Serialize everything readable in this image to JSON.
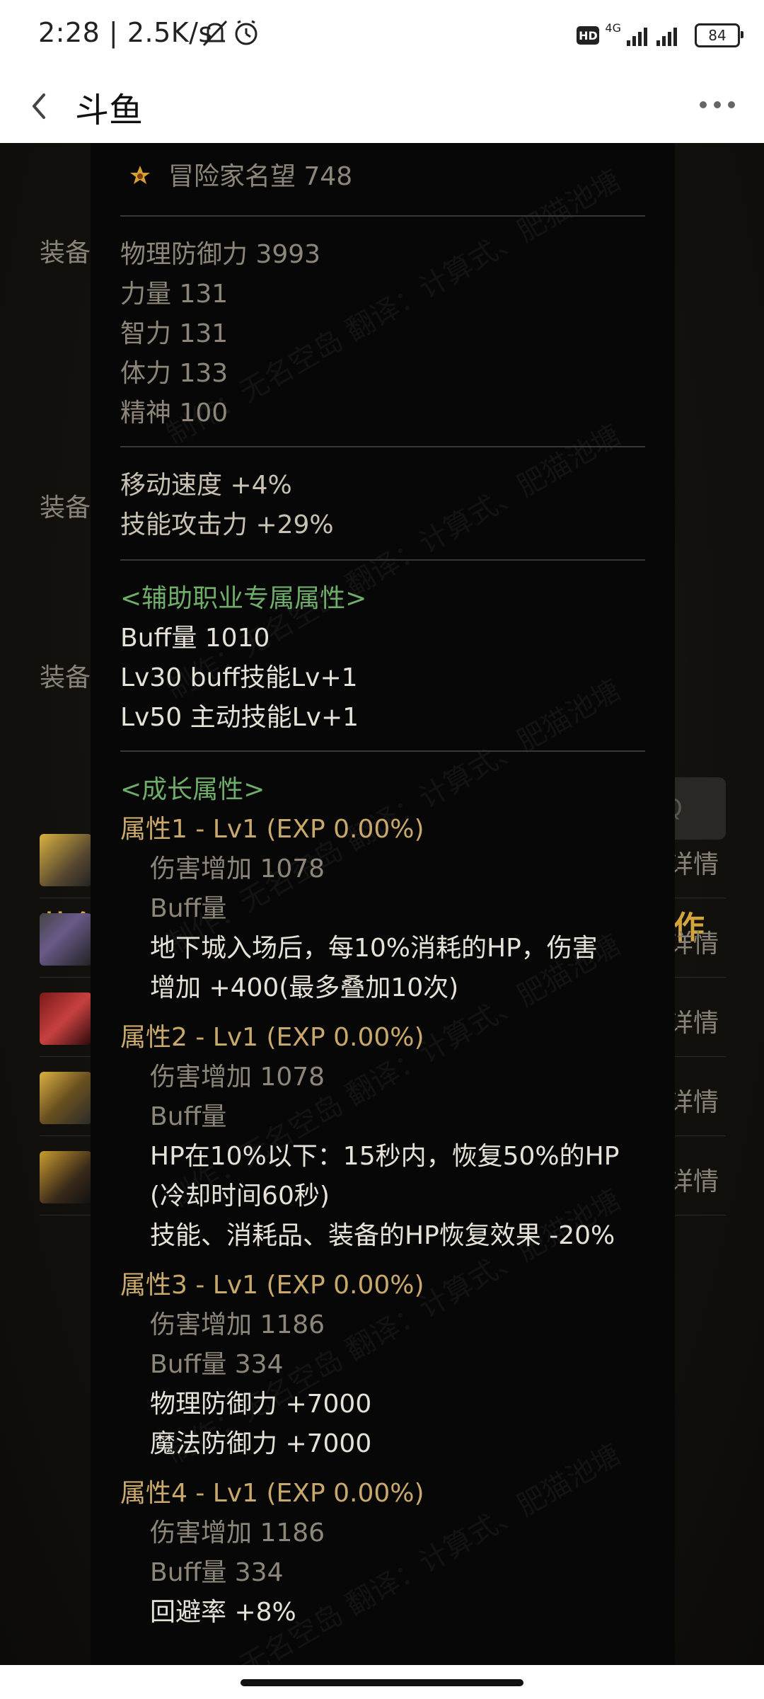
{
  "status_bar": {
    "time": "2:28",
    "speed": "2.5K/s",
    "hd": "HD",
    "network": "4G",
    "battery": "84"
  },
  "navbar": {
    "title": "斗鱼"
  },
  "background": {
    "labels": [
      "装备",
      "装备",
      "装备"
    ],
    "heading_left": "装备",
    "heading_right": "作",
    "row_detail": [
      "详情",
      "详情",
      "详情",
      "详情",
      "详情"
    ],
    "search_glyph": "Q"
  },
  "tooltip": {
    "watermark": [
      "制作：无名空岛 翻译：计算式、肥猫池塘"
    ],
    "fame": "冒险家名望 748",
    "stats": [
      "物理防御力  3993",
      "力量  131",
      "智力  131",
      "体力  133",
      "精神  100"
    ],
    "extra": [
      "移动速度   +4%",
      "技能攻击力   +29%"
    ],
    "support_header": "<辅助职业专属属性>",
    "support": [
      "Buff量   1010",
      "Lv30 buff技能Lv+1",
      "Lv50 主动技能Lv+1"
    ],
    "growth_header": "<成长属性>",
    "growth": [
      {
        "title": "属性1 - Lv1 (EXP 0.00%)",
        "damage": "伤害增加   1078",
        "buff": "Buff量",
        "effects": [
          "地下城入场后，每10%消耗的HP，伤害",
          "增加 +400(最多叠加10次)"
        ]
      },
      {
        "title": "属性2 - Lv1 (EXP 0.00%)",
        "damage": "伤害增加   1078",
        "buff": "Buff量",
        "effects": [
          "HP在10%以下：15秒内，恢复50%的HP",
          "(冷却时间60秒)",
          "技能、消耗品、装备的HP恢复效果 -20%"
        ]
      },
      {
        "title": "属性3 - Lv1 (EXP 0.00%)",
        "damage": "伤害增加   1186",
        "buff": "Buff量   334",
        "effects": [
          "物理防御力 +7000",
          "魔法防御力 +7000"
        ]
      },
      {
        "title": "属性4 - Lv1 (EXP 0.00%)",
        "damage": "伤害增加   1186",
        "buff": "Buff量   334",
        "effects": [
          "回避率 +8%"
        ]
      }
    ]
  },
  "colors": {
    "grey_text": "#8d8679",
    "light_text": "#c9c2b3",
    "green_header": "#6fae6a",
    "gold_title": "#c9a86b",
    "bg_heading": "#d4a53a"
  },
  "icons": {
    "back": "chevron-left-icon",
    "more": "more-dots-icon",
    "fame": "crest-icon",
    "mute": "bell-off-icon",
    "alarm": "alarm-icon"
  }
}
